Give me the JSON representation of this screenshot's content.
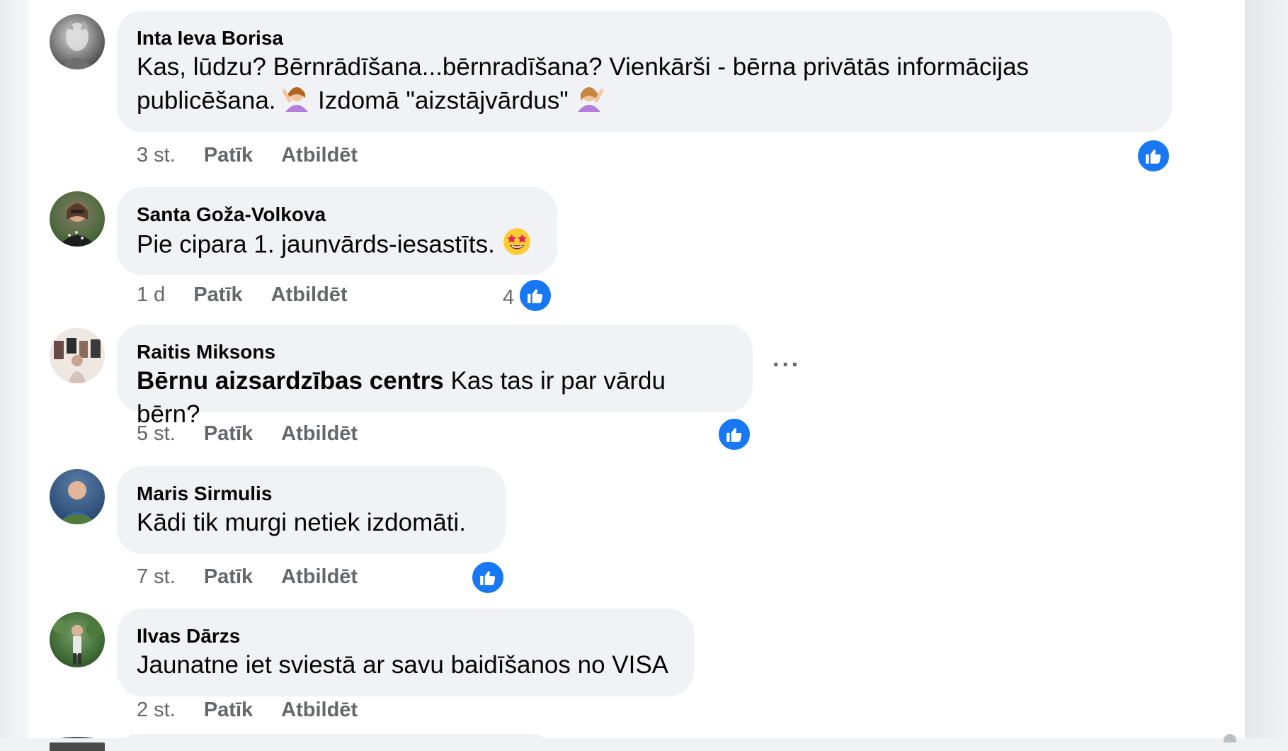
{
  "comments": [
    {
      "author": "Inta Ieva Borisa",
      "text_line1": "Kas, lūdzu? Bērnrādīšana...bērnradīšana? Vienkārši - bērna privātās informācijas",
      "text_line2a": "publicēšana.",
      "text_line2b": " Izdomā \"aizstājvārdus\"",
      "time": "3 st.",
      "like_label": "Patīk",
      "reply_label": "Atbildēt"
    },
    {
      "author": "Santa Goža-Volkova",
      "text": "Pie cipara 1. jaunvārds-iesastīts.",
      "time": "1 d",
      "like_label": "Patīk",
      "reply_label": "Atbildēt",
      "reaction_count": "4"
    },
    {
      "author": "Raitis Miksons",
      "mention": "Bērnu aizsardzības centrs",
      "text": " Kas tas ir par vārdu bērn?",
      "time": "5 st.",
      "like_label": "Patīk",
      "reply_label": "Atbildēt",
      "more": "···"
    },
    {
      "author": "Maris Sirmulis",
      "text": "Kādi tik murgi netiek izdomāti.",
      "time": "7 st.",
      "like_label": "Patīk",
      "reply_label": "Atbildēt"
    },
    {
      "author": "Ilvas Dārzs",
      "text": "Jaunatne iet sviestā ar savu baidīšanos no VISA",
      "time": "2 st.",
      "like_label": "Patīk",
      "reply_label": "Atbildēt"
    }
  ],
  "colors": {
    "like_blue": "#1877f2",
    "bubble_bg": "#f0f2f5",
    "meta_gray": "#65676b",
    "text": "#050505"
  },
  "icons": {
    "like": "thumbs-up-icon",
    "emoji_woman": "woman-raising-hand-emoji",
    "emoji_star": "star-struck-emoji",
    "more": "more-options-icon"
  }
}
